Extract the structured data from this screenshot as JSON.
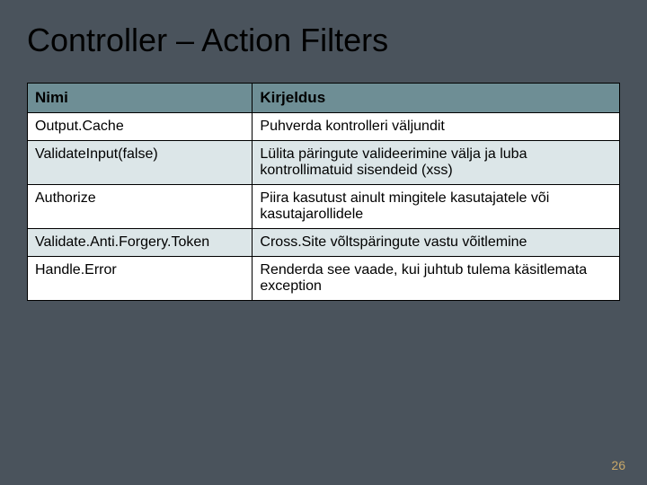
{
  "title": "Controller – Action Filters",
  "page_number": "26",
  "table": {
    "headers": [
      "Nimi",
      "Kirjeldus"
    ],
    "rows": [
      {
        "name": "Output.Cache",
        "desc": "Puhverda kontrolleri väljundit"
      },
      {
        "name": "ValidateInput(false)",
        "desc": "Lülita päringute valideerimine välja ja luba kontrollimatuid sisendeid (xss)"
      },
      {
        "name": "Authorize",
        "desc": "Piira kasutust ainult mingitele kasutajatele või kasutajarollidele"
      },
      {
        "name": "Validate.Anti.Forgery.Token",
        "desc": "Cross.Site võltspäringute vastu võitlemine"
      },
      {
        "name": "Handle.Error",
        "desc": "Renderda see vaade, kui juhtub tulema käsitlemata exception"
      }
    ]
  }
}
